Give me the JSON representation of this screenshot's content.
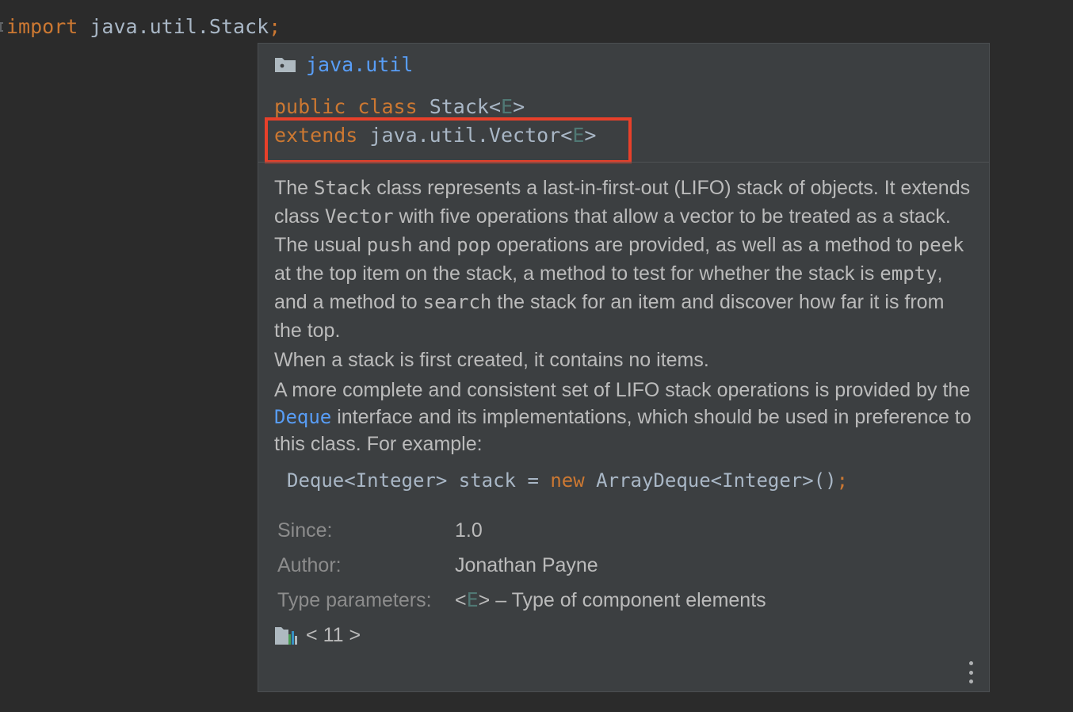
{
  "editor": {
    "fold_marker": "",
    "import_keyword": "import",
    "import_path": "java.util.Stack",
    "import_semicolon": ";"
  },
  "popup": {
    "package": {
      "icon": "package-folder-icon",
      "name": "java.util"
    },
    "declaration": {
      "line1": {
        "kw1": "public",
        "kw2": "class",
        "name": "Stack",
        "lt": "<",
        "param": "E",
        "gt": ">"
      },
      "line2": {
        "kw": "extends",
        "type": "java.util.Vector",
        "lt": "<",
        "param": "E",
        "gt": ">"
      }
    },
    "description": {
      "p1": {
        "t1": "The ",
        "c1": "Stack",
        "t2": " class represents a last-in-first-out (LIFO) stack of objects. It extends class ",
        "c2": "Vector",
        "t3": " with five operations that allow a vector to be treated as a stack. The usual ",
        "c3": "push",
        "t4": " and ",
        "c4": "pop",
        "t5": " operations are provided, as well as a method to ",
        "c5": "peek",
        "t6": " at the top item on the stack, a method to test for whether the stack is ",
        "c6": "empty",
        "t7": ", and a method to ",
        "c7": "search",
        "t8": " the stack for an item and discover how far it is from the top."
      },
      "p2": "When a stack is first created, it contains no items.",
      "p3": {
        "t1": "A more complete and consistent set of LIFO stack operations is provided by the ",
        "link": "Deque",
        "t2": " interface and its implementations, which should be used in preference to this class. For example:"
      }
    },
    "example": {
      "type": "Deque<Integer>",
      "var": "stack",
      "eq": "=",
      "kw_new": "new",
      "ctor": "ArrayDeque<Integer>()",
      "semi": ";"
    },
    "meta": [
      {
        "label": "Since:",
        "value": "1.0"
      },
      {
        "label": "Author:",
        "value": "Jonathan Payne"
      }
    ],
    "type_params": {
      "label": "Type parameters:",
      "lt": "<",
      "param": "E",
      "gt": ">",
      "desc": " – Type of component elements"
    },
    "nav": {
      "icon": "library-icon",
      "prev": "<",
      "version": "11",
      "next": ">"
    },
    "more_icon": "vertical-ellipsis-icon"
  },
  "colors": {
    "editor_bg": "#2b2b2b",
    "popup_bg": "#3c3f41",
    "keyword": "#cc7832",
    "identifier": "#a9b7c6",
    "type_param": "#507874",
    "link": "#589df6",
    "highlight_box": "#e8402a",
    "label": "#8c8c8c"
  }
}
